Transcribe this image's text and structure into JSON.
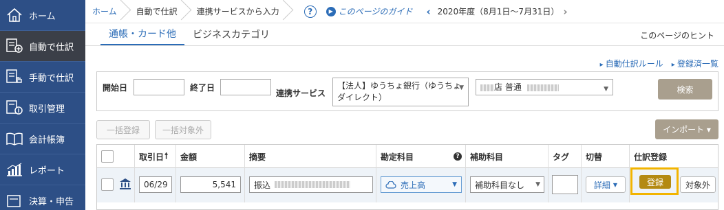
{
  "sidebar": {
    "items": [
      {
        "label": "ホーム",
        "icon": "home-icon"
      },
      {
        "label": "自動で仕訳",
        "icon": "auto-journal-icon"
      },
      {
        "label": "手動で仕訳",
        "icon": "manual-journal-icon"
      },
      {
        "label": "取引管理",
        "icon": "transaction-icon"
      },
      {
        "label": "会計帳簿",
        "icon": "ledger-book-icon"
      },
      {
        "label": "レポート",
        "icon": "report-chart-icon"
      },
      {
        "label": "決算・申告",
        "icon": "settlement-icon"
      }
    ]
  },
  "breadcrumb": [
    "ホーム",
    "自動で仕訳",
    "連携サービスから入力"
  ],
  "help": {
    "icon": "?",
    "guide_label": "このページのガイド"
  },
  "fiscal_year": {
    "label": "2020年度（8月1日〜7月31日）"
  },
  "tabs": {
    "active": "通帳・カード他",
    "other": "ビジネスカテゴリ",
    "hint": "このページのヒント"
  },
  "links": {
    "auto_rule": "自動仕訳ルール",
    "registered": "登録済一覧"
  },
  "filter": {
    "start_label": "開始日",
    "end_label": "終了日",
    "service_label": "連携サービス",
    "service_value": "【法人】ゆうちょ銀行（ゆうちょダイレクト）",
    "account_value": "店 普通",
    "search_label": "検索"
  },
  "actions": {
    "bulk_register": "一括登録",
    "bulk_exclude": "一括対象外",
    "import_label": "インポート ▾"
  },
  "table": {
    "headers": {
      "date": "取引日",
      "amount": "金額",
      "memo": "摘要",
      "account": "勘定科目",
      "sub_account": "補助科目",
      "tag": "タグ",
      "switch": "切替",
      "register": "仕訳登録"
    },
    "row": {
      "date": "06/29",
      "amount": "5,541",
      "memo": "振込",
      "account": "売上高",
      "sub_account": "補助科目なし",
      "tag": "",
      "detail": "詳細",
      "register": "登録",
      "exclude": "対象外"
    }
  },
  "colors": {
    "sidebar": "#2d4f86",
    "accent": "#2b6cb7",
    "register_btn": "#b48a12",
    "highlight": "#f2b400"
  }
}
